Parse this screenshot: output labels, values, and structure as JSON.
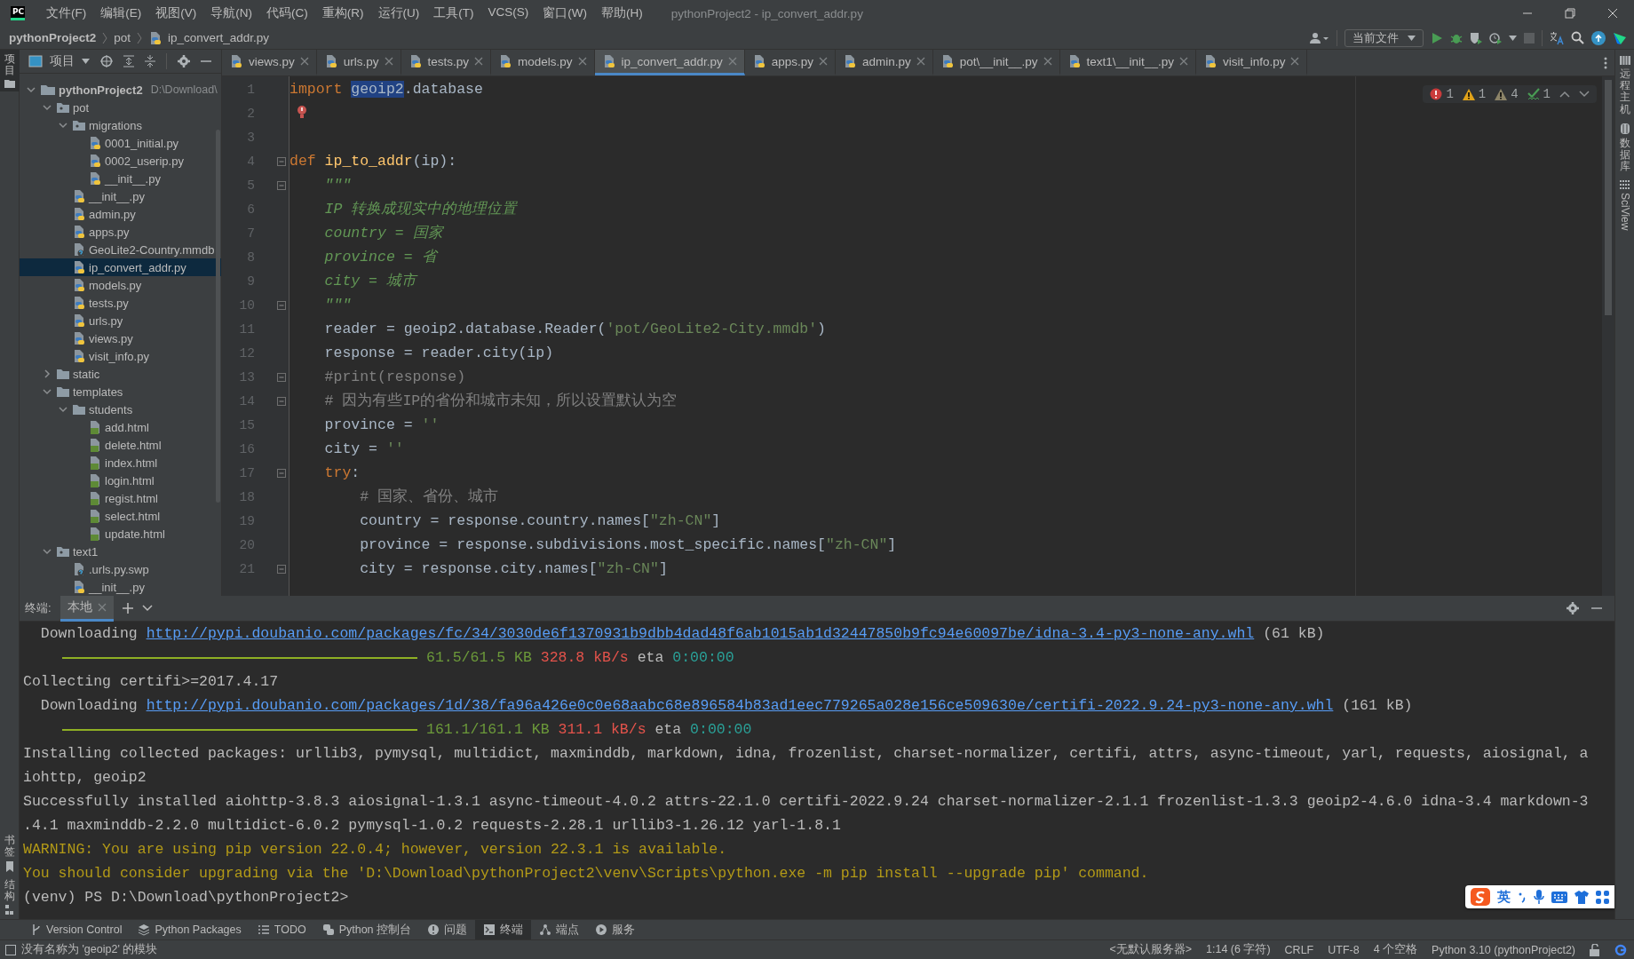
{
  "window": {
    "logo_text": "PC",
    "title": "pythonProject2 - ip_convert_addr.py"
  },
  "menu": [
    "文件(F)",
    "编辑(E)",
    "视图(V)",
    "导航(N)",
    "代码(C)",
    "重构(R)",
    "运行(U)",
    "工具(T)",
    "VCS(S)",
    "窗口(W)",
    "帮助(H)"
  ],
  "breadcrumb": [
    "pythonProject2",
    "pot",
    "ip_convert_addr.py"
  ],
  "run_config": "当前文件",
  "left_stripe": {
    "top": [
      {
        "label": "项目",
        "selected": true
      }
    ],
    "bottom": [
      {
        "label": "书签",
        "selected": false
      },
      {
        "label": "结构",
        "selected": false
      }
    ]
  },
  "right_stripe": [
    {
      "label": "远程主机",
      "kind": "server"
    },
    {
      "label": "数据库",
      "kind": "database"
    },
    {
      "label": "SciView",
      "kind": "grid"
    }
  ],
  "project_panel": {
    "title": "项目"
  },
  "project_tree": [
    {
      "name": "pythonProject2",
      "path": "D:\\Download\\",
      "kind": "project",
      "expanded": true,
      "selected": false,
      "children": [
        {
          "name": "pot",
          "kind": "package",
          "expanded": true,
          "selected": false,
          "children": [
            {
              "name": "migrations",
              "kind": "package",
              "expanded": true,
              "selected": false,
              "children": [
                {
                  "name": "0001_initial.py",
                  "kind": "py",
                  "selected": false
                },
                {
                  "name": "0002_userip.py",
                  "kind": "py",
                  "selected": false
                },
                {
                  "name": "__init__.py",
                  "kind": "py",
                  "selected": false
                }
              ]
            },
            {
              "name": "__init__.py",
              "kind": "py",
              "selected": false
            },
            {
              "name": "admin.py",
              "kind": "py",
              "selected": false
            },
            {
              "name": "apps.py",
              "kind": "py",
              "selected": false
            },
            {
              "name": "GeoLite2-Country.mmdb",
              "kind": "unknown",
              "selected": false
            },
            {
              "name": "ip_convert_addr.py",
              "kind": "py",
              "selected": true
            },
            {
              "name": "models.py",
              "kind": "py",
              "selected": false
            },
            {
              "name": "tests.py",
              "kind": "py",
              "selected": false
            },
            {
              "name": "urls.py",
              "kind": "py",
              "selected": false
            },
            {
              "name": "views.py",
              "kind": "py",
              "selected": false
            },
            {
              "name": "visit_info.py",
              "kind": "py",
              "selected": false
            }
          ]
        },
        {
          "name": "static",
          "kind": "folder",
          "expanded": false,
          "selected": false
        },
        {
          "name": "templates",
          "kind": "folder",
          "expanded": true,
          "selected": false,
          "children": [
            {
              "name": "students",
              "kind": "folder",
              "expanded": true,
              "selected": false,
              "children": [
                {
                  "name": "add.html",
                  "kind": "html",
                  "selected": false
                },
                {
                  "name": "delete.html",
                  "kind": "html",
                  "selected": false
                },
                {
                  "name": "index.html",
                  "kind": "html",
                  "selected": false
                },
                {
                  "name": "login.html",
                  "kind": "html",
                  "selected": false
                },
                {
                  "name": "regist.html",
                  "kind": "html",
                  "selected": false
                },
                {
                  "name": "select.html",
                  "kind": "html",
                  "selected": false
                },
                {
                  "name": "update.html",
                  "kind": "html",
                  "selected": false
                }
              ]
            }
          ]
        },
        {
          "name": "text1",
          "kind": "package",
          "expanded": true,
          "selected": false,
          "children": [
            {
              "name": ".urls.py.swp",
              "kind": "unknown",
              "selected": false
            },
            {
              "name": "__init__.py",
              "kind": "py",
              "selected": false
            }
          ]
        }
      ]
    }
  ],
  "editor_tabs": [
    {
      "label": "views.py",
      "selected": false
    },
    {
      "label": "urls.py",
      "selected": false
    },
    {
      "label": "tests.py",
      "selected": false
    },
    {
      "label": "models.py",
      "selected": false
    },
    {
      "label": "ip_convert_addr.py",
      "selected": true
    },
    {
      "label": "apps.py",
      "selected": false
    },
    {
      "label": "admin.py",
      "selected": false
    },
    {
      "label": "pot\\__init__.py",
      "selected": false
    },
    {
      "label": "text1\\__init__.py",
      "selected": false
    },
    {
      "label": "visit_info.py",
      "selected": false
    }
  ],
  "inspections": [
    {
      "kind": "error",
      "count": "1"
    },
    {
      "kind": "warning",
      "count": "1"
    },
    {
      "kind": "weak_warning",
      "count": "4"
    },
    {
      "kind": "typo",
      "count": "1"
    }
  ],
  "code_lines": [
    {
      "number": "1",
      "fold": false,
      "tokens": [
        {
          "kind": "kw",
          "text": "import "
        },
        {
          "kind": "sel",
          "text": "geoip2"
        },
        {
          "kind": "plain",
          "text": ".database"
        }
      ]
    },
    {
      "number": "2",
      "fold": false,
      "bulb": true
    },
    {
      "number": "3",
      "fold": false
    },
    {
      "number": "4",
      "fold": true,
      "tokens": [
        {
          "kind": "kw",
          "text": "def "
        },
        {
          "kind": "fn",
          "text": "ip_to_addr"
        },
        {
          "kind": "plain",
          "text": "(ip):"
        }
      ]
    },
    {
      "number": "5",
      "fold": true,
      "tokens": [
        {
          "kind": "doc",
          "text": "    \"\"\""
        }
      ]
    },
    {
      "number": "6",
      "fold": false,
      "tokens": [
        {
          "kind": "doc",
          "text": "    IP 转换成现实中的地理位置"
        }
      ]
    },
    {
      "number": "7",
      "fold": false,
      "tokens": [
        {
          "kind": "doc",
          "text": "    country = 国家"
        }
      ]
    },
    {
      "number": "8",
      "fold": false,
      "tokens": [
        {
          "kind": "doc",
          "text": "    province = 省"
        }
      ]
    },
    {
      "number": "9",
      "fold": false,
      "tokens": [
        {
          "kind": "doc",
          "text": "    city = 城市"
        }
      ]
    },
    {
      "number": "10",
      "fold": true,
      "tokens": [
        {
          "kind": "doc",
          "text": "    \"\"\""
        }
      ]
    },
    {
      "number": "11",
      "fold": false,
      "tokens": [
        {
          "kind": "plain",
          "text": "    reader = geoip2.database.Reader("
        },
        {
          "kind": "str",
          "text": "'pot/GeoLite2-City.mmdb'"
        },
        {
          "kind": "plain",
          "text": ")"
        }
      ]
    },
    {
      "number": "12",
      "fold": false,
      "tokens": [
        {
          "kind": "plain",
          "text": "    response = reader.city(ip)"
        }
      ]
    },
    {
      "number": "13",
      "fold": true,
      "tokens": [
        {
          "kind": "comment",
          "text": "    #print(response)"
        }
      ]
    },
    {
      "number": "14",
      "fold": true,
      "tokens": [
        {
          "kind": "comment",
          "text": "    # 因为有些IP的省份和城市未知，所以设置默认为空"
        }
      ]
    },
    {
      "number": "15",
      "fold": false,
      "tokens": [
        {
          "kind": "plain",
          "text": "    province = "
        },
        {
          "kind": "str",
          "text": "''"
        }
      ]
    },
    {
      "number": "16",
      "fold": false,
      "tokens": [
        {
          "kind": "plain",
          "text": "    city = "
        },
        {
          "kind": "str",
          "text": "''"
        }
      ]
    },
    {
      "number": "17",
      "fold": true,
      "tokens": [
        {
          "kind": "kw",
          "text": "    try"
        },
        {
          "kind": "plain",
          "text": ":"
        }
      ]
    },
    {
      "number": "18",
      "fold": false,
      "tokens": [
        {
          "kind": "comment",
          "text": "        # 国家、省份、城市"
        }
      ]
    },
    {
      "number": "19",
      "fold": false,
      "tokens": [
        {
          "kind": "plain",
          "text": "        country = response.country.names["
        },
        {
          "kind": "str",
          "text": "\"zh-CN\""
        },
        {
          "kind": "plain",
          "text": "]"
        }
      ]
    },
    {
      "number": "20",
      "fold": false,
      "tokens": [
        {
          "kind": "plain",
          "text": "        province = response.subdivisions.most_specific.names["
        },
        {
          "kind": "str",
          "text": "\"zh-CN\""
        },
        {
          "kind": "plain",
          "text": "]"
        }
      ]
    },
    {
      "number": "21",
      "fold": true,
      "tokens": [
        {
          "kind": "plain",
          "text": "        city = response.city.names["
        },
        {
          "kind": "str",
          "text": "\"zh-CN\""
        },
        {
          "kind": "plain",
          "text": "]"
        }
      ]
    }
  ],
  "terminal": {
    "label": "终端:",
    "tabs": [
      {
        "label": "本地",
        "selected": true
      }
    ],
    "lines": [
      {
        "kind": "download",
        "prefix": "  Downloading ",
        "link": "http://pypi.doubanio.com/packages/fc/34/3030de6f1370931b9dbb4dad48f6ab1015ab1d32447850b9fc94e60097be/idna-3.4-py3-none-any.whl",
        "suffix": " (61 kB)"
      },
      {
        "kind": "progress",
        "level": 1,
        "size": "61.5/61.5 KB",
        "speed": "328.8 kB/s",
        "eta_label": "eta",
        "eta": "0:00:00"
      },
      {
        "kind": "text",
        "text": "Collecting certifi>=2017.4.17"
      },
      {
        "kind": "download",
        "prefix": "  Downloading ",
        "link": "http://pypi.doubanio.com/packages/1d/38/fa96a426e0c0e68aabc68e896584b83ad1eec779265a028e156ce509630e/certifi-2022.9.24-py3-none-any.whl",
        "suffix": " (161 kB)"
      },
      {
        "kind": "progress",
        "level": 1,
        "size": "161.1/161.1 KB",
        "speed": "311.1 kB/s",
        "eta_label": "eta",
        "eta": "0:00:00"
      },
      {
        "kind": "text",
        "text": "Installing collected packages: urllib3, pymysql, multidict, maxminddb, markdown, idna, frozenlist, charset-normalizer, certifi, attrs, async-timeout, yarl, requests, aiosignal, a"
      },
      {
        "kind": "text",
        "text": "iohttp, geoip2"
      },
      {
        "kind": "text",
        "text": "Successfully installed aiohttp-3.8.3 aiosignal-1.3.1 async-timeout-4.0.2 attrs-22.1.0 certifi-2022.9.24 charset-normalizer-2.1.1 frozenlist-1.3.3 geoip2-4.6.0 idna-3.4 markdown-3"
      },
      {
        "kind": "text",
        "text": ".4.1 maxminddb-2.2.0 multidict-6.0.2 pymysql-1.0.2 requests-2.28.1 urllib3-1.26.12 yarl-1.8.1"
      },
      {
        "kind": "warning",
        "text": "WARNING: You are using pip version 22.0.4; however, version 22.3.1 is available."
      },
      {
        "kind": "warning",
        "text": "You should consider upgrading via the 'D:\\Download\\pythonProject2\\venv\\Scripts\\python.exe -m pip install --upgrade pip' command."
      },
      {
        "kind": "text",
        "text": "(venv) PS D:\\Download\\pythonProject2>"
      }
    ]
  },
  "ime": {
    "mode": "英"
  },
  "tool_windows": [
    {
      "label": "Version Control",
      "kind": "vcs",
      "selected": false
    },
    {
      "label": "Python Packages",
      "kind": "packages",
      "selected": false
    },
    {
      "label": "TODO",
      "kind": "todo",
      "selected": false
    },
    {
      "label": "Python 控制台",
      "kind": "console",
      "selected": false
    },
    {
      "label": "问题",
      "kind": "problems",
      "selected": false
    },
    {
      "label": "终端",
      "kind": "terminal",
      "selected": true
    },
    {
      "label": "端点",
      "kind": "endpoints",
      "selected": false
    },
    {
      "label": "服务",
      "kind": "services",
      "selected": false
    }
  ],
  "status_bar": {
    "message": "没有名称为 'geoip2' 的模块",
    "items": [
      "<无默认服务器>",
      "1:14 (6 字符)",
      "CRLF",
      "UTF-8",
      "4 个空格",
      "Python 3.10 (pythonProject2)"
    ]
  }
}
